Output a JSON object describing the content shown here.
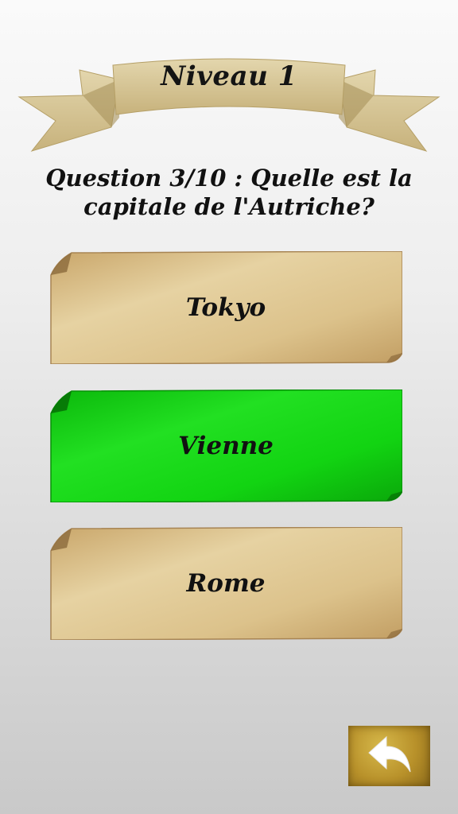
{
  "header": {
    "level_title": "Niveau 1"
  },
  "question": {
    "text": "Question 3/10 : Quelle est la capitale de l'Autriche?"
  },
  "answers": [
    {
      "label": "Tokyo",
      "state": "neutral"
    },
    {
      "label": "Vienne",
      "state": "correct"
    },
    {
      "label": "Rome",
      "state": "neutral"
    }
  ],
  "colors": {
    "parchment": "#dcc28b",
    "parchment_dark": "#b8955a",
    "correct": "#12d412",
    "correct_dark": "#0a9a0a",
    "button_gold": "#b8912a"
  },
  "icons": {
    "back": "back-arrow-icon"
  }
}
